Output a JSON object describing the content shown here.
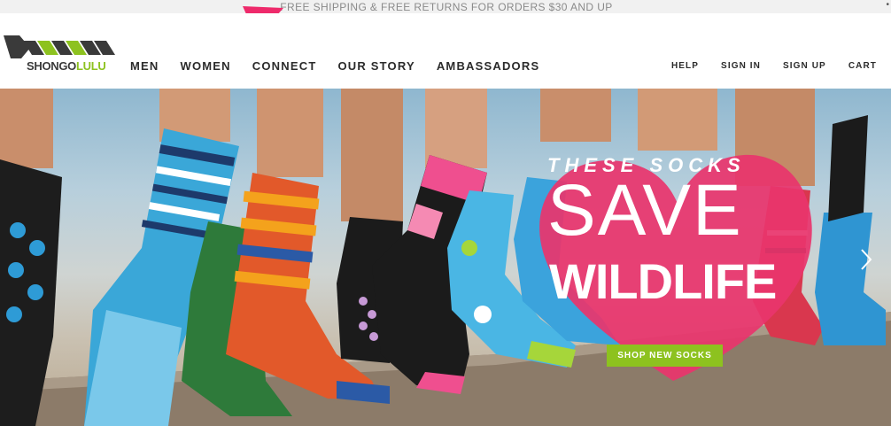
{
  "announcement": {
    "text": "FREE SHIPPING & FREE RETURNS FOR ORDERS $30 AND UP"
  },
  "brand": {
    "name_part1": "SHONGO",
    "name_part2": "LULU",
    "accent": "#8dc21f"
  },
  "nav": {
    "main": [
      {
        "label": "MEN"
      },
      {
        "label": "WOMEN"
      },
      {
        "label": "CONNECT"
      },
      {
        "label": "OUR STORY"
      },
      {
        "label": "AMBASSADORS"
      }
    ],
    "utility": [
      {
        "label": "HELP"
      },
      {
        "label": "SIGN IN"
      },
      {
        "label": "SIGN UP"
      },
      {
        "label": "CART"
      }
    ]
  },
  "hero": {
    "kicker": "THESE SOCKS",
    "headline_line1": "SAVE",
    "headline_line2": "WILDLIFE",
    "cta_label": "SHOP NEW SOCKS",
    "heart_color": "#e8356d",
    "annotation_arrow_color": "#ee2a6b"
  }
}
